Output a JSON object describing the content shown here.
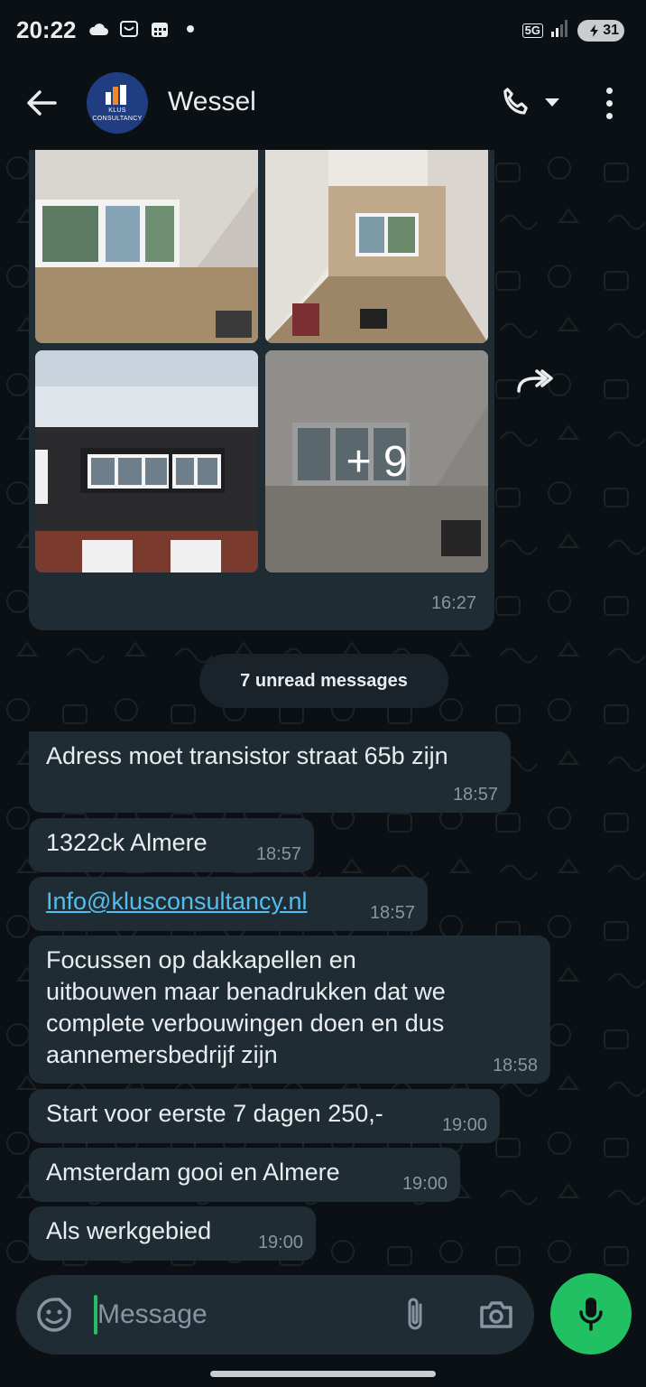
{
  "status_bar": {
    "time": "20:22",
    "network": "5G",
    "battery": "31",
    "left_icons": [
      "cloud-icon",
      "inbox-icon",
      "calendar-icon",
      "dot-icon"
    ]
  },
  "header": {
    "contact_name": "Wessel",
    "avatar_text": "KLUS CONSULTANCY"
  },
  "media_message": {
    "more_count": "+ 9",
    "time": "16:27"
  },
  "unread_label": "7 unread messages",
  "messages": [
    {
      "text": "Adress moet transistor straat 65b zijn",
      "time": "18:57"
    },
    {
      "text": "1322ck Almere",
      "time": "18:57"
    },
    {
      "text": "Info@klusconsultancy.nl",
      "time": "18:57",
      "link": true
    },
    {
      "text": "Focussen op dakkapellen en\nuitbouwen maar benadrukken dat we\ncomplete verbouwingen doen en dus\naannemersbedrijf zijn",
      "time": "18:58"
    },
    {
      "text": "Start voor eerste 7 dagen 250,-",
      "time": "19:00"
    },
    {
      "text": "Amsterdam gooi en Almere",
      "time": "19:00"
    },
    {
      "text": "Als werkgebied",
      "time": "19:00"
    }
  ],
  "input": {
    "placeholder": "Message",
    "value": ""
  },
  "colors": {
    "background": "#0b1014",
    "bubble": "#202c33",
    "accent_green": "#21c063",
    "link": "#53bdeb",
    "timestamp": "#8696a0"
  }
}
